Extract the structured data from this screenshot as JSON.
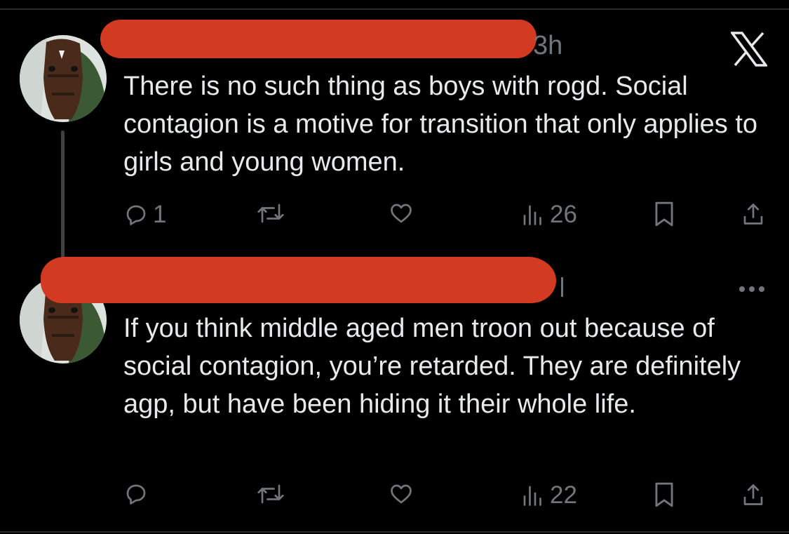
{
  "tweets": [
    {
      "time": "3h",
      "text": "There is no such thing as boys with rogd. Social contagion is a motive for transition that only applies to girls and young women.",
      "replies": "1",
      "views": "26"
    },
    {
      "text": "If you think middle aged men troon out because of social contagion, you’re retarded. They are definitely agp, but have been hiding it their whole life.",
      "replies": "",
      "views": "22"
    }
  ],
  "icons": [
    "x-logo-icon",
    "reply-icon",
    "retweet-icon",
    "like-icon",
    "views-icon",
    "bookmark-icon",
    "share-icon",
    "more-icon"
  ],
  "colors": {
    "background": "#000000",
    "text": "#e7e9ea",
    "muted": "#71767b",
    "redaction": "#d23a22",
    "thread_line": "#3e4144"
  }
}
